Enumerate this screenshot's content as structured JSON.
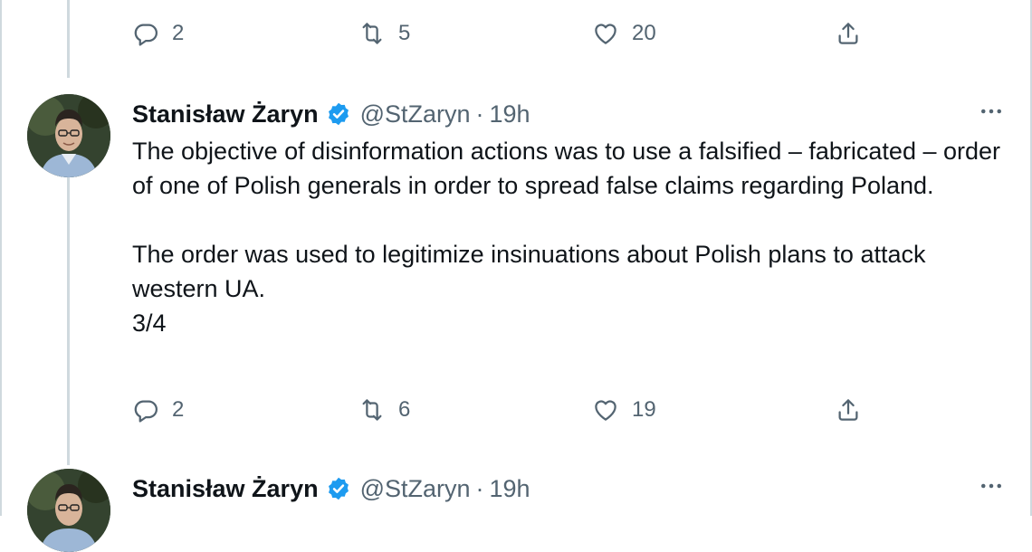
{
  "top_actions": {
    "replies": "2",
    "retweets": "5",
    "likes": "20"
  },
  "tweet1": {
    "name": "Stanisław Żaryn",
    "handle": "@StZaryn",
    "separator": "·",
    "time": "19h",
    "paragraphs": [
      "The objective of disinformation actions was to use a falsified – fabricated – order of one of Polish generals in order to spread false claims regarding Poland.",
      "The order was used to legitimize insinuations about Polish plans to attack western UA.",
      "3/4"
    ],
    "actions": {
      "replies": "2",
      "retweets": "6",
      "likes": "19"
    }
  },
  "tweet2": {
    "name": "Stanisław Żaryn",
    "handle": "@StZaryn",
    "separator": "·",
    "time": "19h"
  },
  "colors": {
    "verified": "#1d9bf0",
    "muted": "#536471",
    "text": "#0f1419",
    "thread_line": "#cfd9de"
  },
  "icons": [
    "reply-icon",
    "retweet-icon",
    "like-icon",
    "share-icon",
    "verified-badge-icon",
    "more-options-icon"
  ]
}
